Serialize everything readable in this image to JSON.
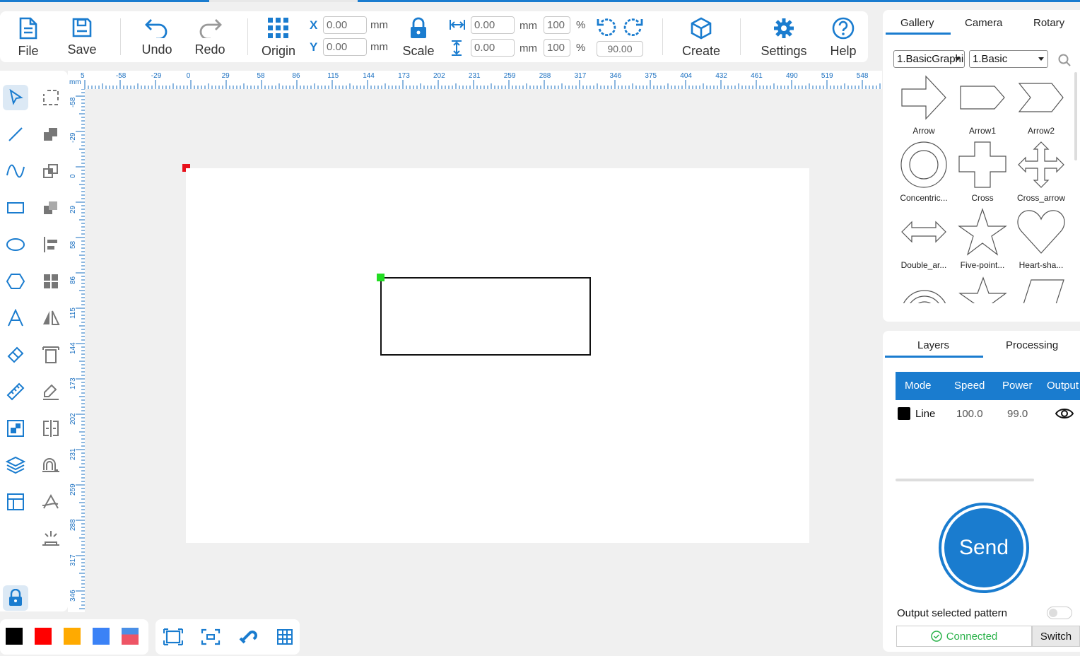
{
  "toolbar": {
    "file": "File",
    "save": "Save",
    "undo": "Undo",
    "redo": "Redo",
    "origin": "Origin",
    "x_label": "X",
    "y_label": "Y",
    "x_value": "0.00",
    "y_value": "0.00",
    "unit_mm": "mm",
    "scale": "Scale",
    "width_value": "0.00",
    "height_value": "0.00",
    "width_percent": "100",
    "height_percent": "100",
    "percent": "%",
    "rotation": "90.00",
    "create": "Create",
    "settings": "Settings",
    "help": "Help"
  },
  "rulers": {
    "unit": "mm",
    "h_ticks": [
      "5",
      "-58",
      "-29",
      "0",
      "29",
      "58",
      "86",
      "115",
      "144",
      "173",
      "202",
      "231",
      "259",
      "288",
      "317",
      "346",
      "375",
      "404",
      "432",
      "461",
      "490",
      "519",
      "548"
    ],
    "v_ticks": [
      "-58",
      "-29",
      "0",
      "29",
      "58",
      "86",
      "115",
      "144",
      "173",
      "202",
      "231",
      "259",
      "288",
      "317",
      "346"
    ]
  },
  "gallery": {
    "tabs": [
      "Gallery",
      "Camera",
      "Rotary"
    ],
    "category_select": "1.BasicGraphics",
    "subcategory_select": "1.Basic",
    "shapes": [
      {
        "name": "Arrow",
        "icon": "arrow-shape"
      },
      {
        "name": "Arrow1",
        "icon": "arrow1-shape"
      },
      {
        "name": "Arrow2",
        "icon": "arrow2-shape"
      },
      {
        "name": "Concentric...",
        "icon": "concentric-shape"
      },
      {
        "name": "Cross",
        "icon": "cross-shape"
      },
      {
        "name": "Cross_arrow",
        "icon": "cross-arrow-shape"
      },
      {
        "name": "Double_ar...",
        "icon": "double-arrow-shape"
      },
      {
        "name": "Five-point...",
        "icon": "five-point-star-shape"
      },
      {
        "name": "Heart-sha...",
        "icon": "heart-shape"
      }
    ]
  },
  "layers": {
    "tabs": [
      "Layers",
      "Processing"
    ],
    "headers": [
      "Mode",
      "Speed",
      "Power",
      "Output"
    ],
    "rows": [
      {
        "color": "#000000",
        "mode": "Line",
        "speed": "100.0",
        "power": "99.0",
        "output": "eye-icon"
      }
    ],
    "send": "Send",
    "output_selected": "Output selected pattern",
    "status": "Connected",
    "switch": "Switch"
  },
  "colors": {
    "accent": "#1a7ccf",
    "swatches": [
      "#000000",
      "#ff0000",
      "#ffaa00",
      "#3b82f6",
      "#ee5566"
    ],
    "connected": "#2ab24a"
  }
}
